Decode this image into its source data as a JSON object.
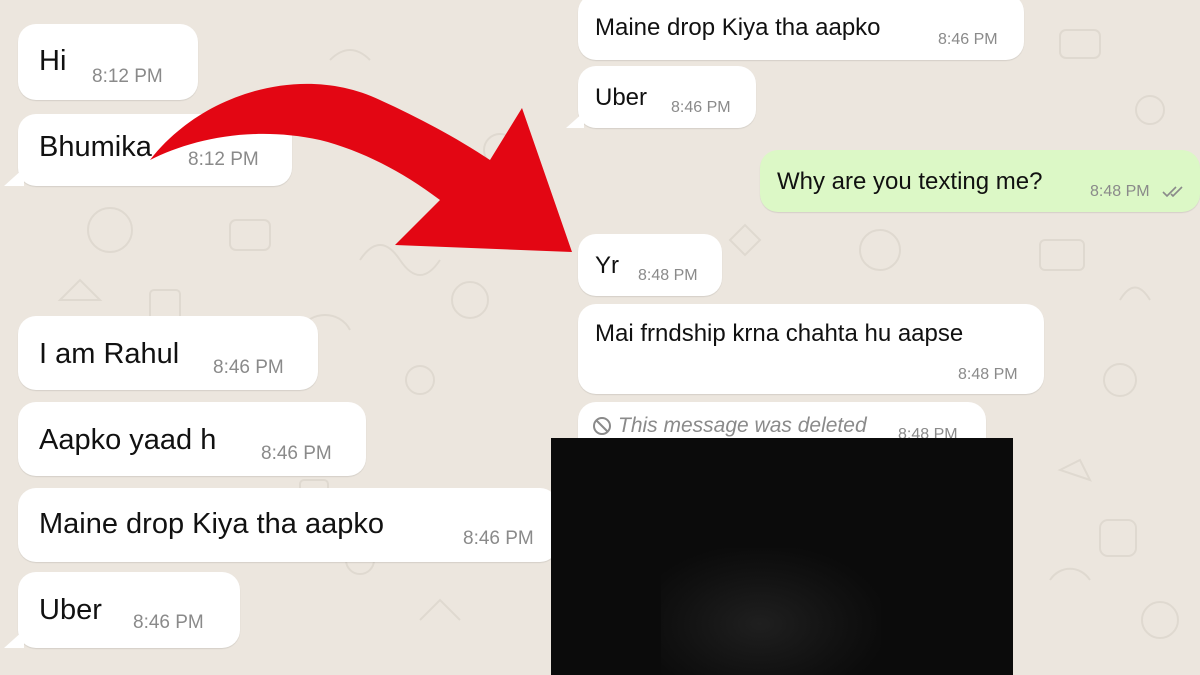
{
  "colors": {
    "background": "#ECE6DE",
    "incoming_bubble": "#FFFFFF",
    "outgoing_bubble": "#DCF8C6",
    "arrow": "#E30613",
    "time_text": "#8A8A8A",
    "read_ticks": "#8A8A8A"
  },
  "left_chat": {
    "messages": [
      {
        "text": "Hi",
        "time": "8:12 PM"
      },
      {
        "text": "Bhumika",
        "time": "8:12 PM"
      },
      {
        "text": "I am Rahul",
        "time": "8:46 PM"
      },
      {
        "text": "Aapko yaad h",
        "time": "8:46 PM"
      },
      {
        "text": "Maine drop Kiya tha aapko",
        "time": "8:46 PM"
      },
      {
        "text": "Uber",
        "time": "8:46 PM"
      }
    ]
  },
  "right_chat": {
    "messages": [
      {
        "text": "Maine drop Kiya tha aapko",
        "time": "8:46 PM"
      },
      {
        "text": "Uber",
        "time": "8:46 PM"
      },
      {
        "text": "Why are you texting me?",
        "time": "8:48 PM",
        "ticks_icon": "double-check-icon"
      },
      {
        "text": "Yr",
        "time": "8:48 PM"
      },
      {
        "text": "Mai frndship krna chahta hu aapse",
        "time": "8:48 PM"
      },
      {
        "text": "This message was deleted",
        "time": "8:48 PM",
        "icon": "blocked-circle-icon"
      }
    ]
  },
  "overlays": {
    "arrow_icon": "curved-red-arrow-icon",
    "redaction": "redacted-photo"
  }
}
